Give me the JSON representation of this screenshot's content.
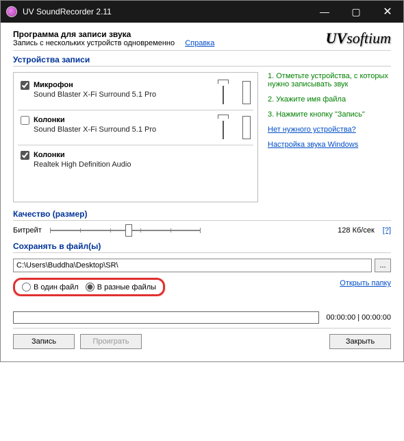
{
  "window": {
    "title": "UV SoundRecorder 2.11"
  },
  "header": {
    "title": "Программа для записи звука",
    "subtitle": "Запись с нескольких устройств одновременно",
    "help": "Справка",
    "logo_uv": "UV",
    "logo_softium": "softium"
  },
  "sections": {
    "devices_title": "Устройства записи",
    "quality_title": "Качество (размер)",
    "save_title": "Сохранять в файл(ы)"
  },
  "devices": [
    {
      "checked": true,
      "name": "Микрофон",
      "desc": "Sound Blaster X-Fi Surround 5.1 Pro"
    },
    {
      "checked": false,
      "name": "Колонки",
      "desc": "Sound Blaster X-Fi Surround 5.1 Pro"
    },
    {
      "checked": true,
      "name": "Колонки",
      "desc": "Realtek High Definition Audio"
    }
  ],
  "tips": {
    "t1": "1. Отметьте устройства, с которых нужно записывать звук",
    "t2": "2. Укажите имя файла",
    "t3": "3. Нажмите кнопку \"Запись\"",
    "link1": "Нет нужного устройства?",
    "link2": "Настройка звука Windows"
  },
  "quality": {
    "bitrate_label": "Битрейт",
    "bitrate_value": "128 Кб/сек",
    "help": "[?]"
  },
  "save": {
    "path": "C:\\Users\\Buddha\\Desktop\\SR\\",
    "browse": "...",
    "radio_single": "В один файл",
    "radio_multi": "В разные файлы",
    "open": "Открыть папку"
  },
  "progress": {
    "time": "00:00:00 | 00:00:00"
  },
  "buttons": {
    "record": "Запись",
    "play": "Проиграть",
    "close": "Закрыть"
  }
}
